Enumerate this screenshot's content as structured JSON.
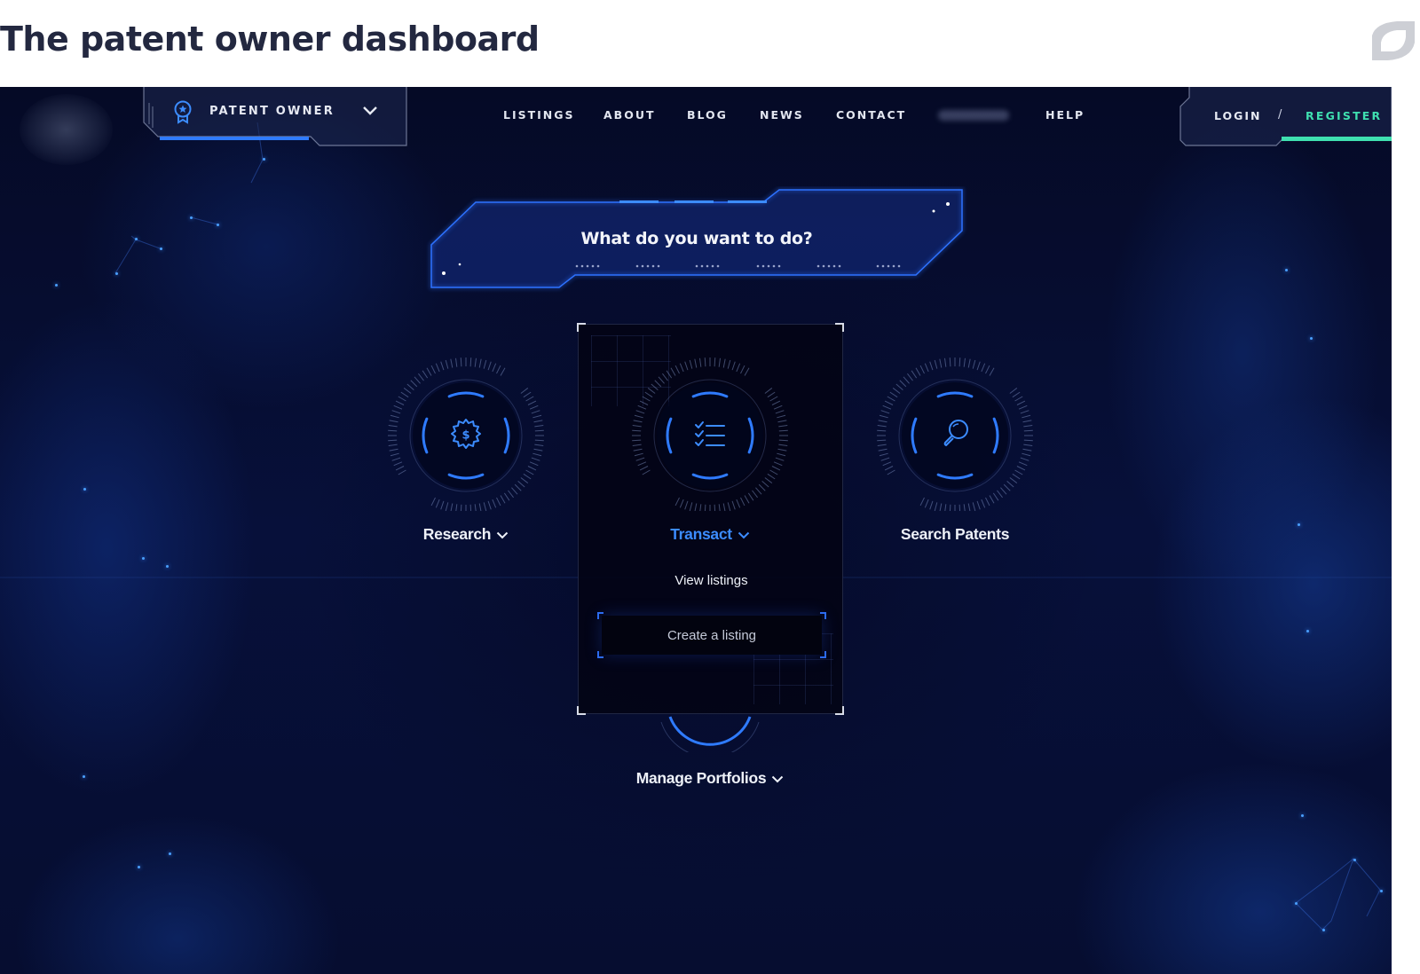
{
  "page": {
    "heading": "The patent owner dashboard"
  },
  "app": {
    "role_selector": {
      "label": "PATENT OWNER",
      "icon": "award-badge-icon"
    },
    "nav": [
      {
        "label": "LISTINGS"
      },
      {
        "label": "ABOUT"
      },
      {
        "label": "BLOG"
      },
      {
        "label": "NEWS"
      },
      {
        "label": "CONTACT"
      },
      {
        "label": "HELP"
      }
    ],
    "auth": {
      "login_label": "LOGIN",
      "separator": "/",
      "register_label": "REGISTER"
    },
    "prompt": "What do you want to do?",
    "actions": [
      {
        "label": "Research",
        "icon": "gear-dollar-icon",
        "has_dropdown": true,
        "active": false
      },
      {
        "label": "Transact",
        "icon": "checklist-icon",
        "has_dropdown": true,
        "active": true
      },
      {
        "label": "Search Patents",
        "icon": "magnifier-icon",
        "has_dropdown": false,
        "active": false
      },
      {
        "label": "Manage Portfolios",
        "icon": "portfolio-icon",
        "has_dropdown": true,
        "active": false
      }
    ],
    "transact_menu": {
      "items": [
        {
          "label": "View listings",
          "highlighted": false
        },
        {
          "label": "Create a listing",
          "highlighted": true
        }
      ]
    },
    "colors": {
      "accent_blue": "#3c8cff",
      "register_green": "#3fe0b0",
      "heading_navy": "#232840",
      "background_navy": "#060d30"
    }
  }
}
